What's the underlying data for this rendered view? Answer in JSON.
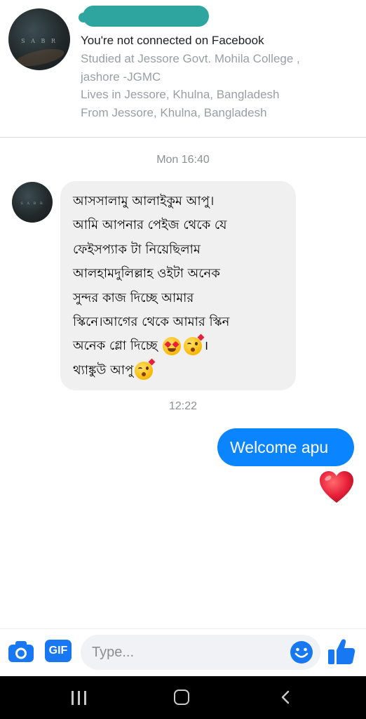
{
  "profile": {
    "connection_status": "You're not connected on Facebook",
    "details": [
      "Studied at Jessore Govt. Mohila College ,",
      "jashore -JGMC",
      "Lives in Jessore, Khulna, Bangladesh",
      "From Jessore, Khulna, Bangladesh"
    ],
    "avatar_monogram": "S A B R"
  },
  "conversation": {
    "timestamp_1": "Mon 16:40",
    "incoming_message_lines": [
      "আসসালামু আলাইকুম আপু।",
      "আমি আপনার পেইজ থেকে যে",
      "ফেইসপ্যাক টা নিয়েছিলাম",
      "আলহামদুলিল্লাহ ওইটা অনেক",
      "সুন্দর কাজ দিচ্ছে আমার",
      "স্কিনে।আগের থেকে আমার স্কিন",
      "অনেক গ্লো দিচ্ছে",
      "।",
      "থ্যাঙ্কুউ আপু"
    ],
    "incoming_emojis": [
      "heart-eyes-emoji",
      "face-blowing-kiss-emoji"
    ],
    "timestamp_2": "12:22",
    "outgoing_message": "Welcome apu",
    "reaction": "red-heart"
  },
  "composer": {
    "camera_icon": "camera-icon",
    "gif_label": "GIF",
    "placeholder": "Type...",
    "emoji_icon": "smiley-icon",
    "like_icon": "thumbs-up-icon"
  },
  "colors": {
    "accent": "#1877f2",
    "outgoing_bubble": "#0a84ff",
    "incoming_bubble": "#f1f0f0",
    "redaction": "#2fa5a0",
    "heart": "#e8213b"
  }
}
